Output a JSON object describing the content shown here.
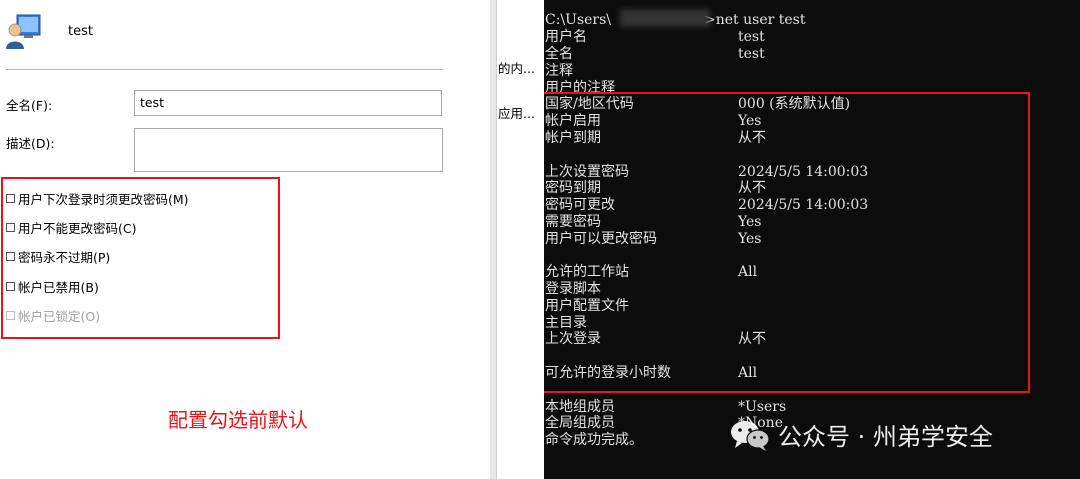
{
  "dialog": {
    "user_name": "test",
    "fullname_label": "全名(F):",
    "fullname_value": "test",
    "description_label": "描述(D):",
    "checkboxes": [
      {
        "label": "用户下次登录时须更改密码(M)",
        "checked": false,
        "disabled": false
      },
      {
        "label": "用户不能更改密码(C)",
        "checked": false,
        "disabled": false
      },
      {
        "label": "密码永不过期(P)",
        "checked": false,
        "disabled": false
      },
      {
        "label": "帐户已禁用(B)",
        "checked": false,
        "disabled": false
      },
      {
        "label": "帐户已锁定(O)",
        "checked": false,
        "disabled": true
      }
    ],
    "annotation": "配置勾选前默认"
  },
  "middle": {
    "line1": "的内...",
    "line2": "应用..."
  },
  "console": {
    "command_prefix": "C:\\Users\\",
    "command_suffix": ">net user test",
    "rows": [
      {
        "key": "用户名",
        "value": "test"
      },
      {
        "key": "全名",
        "value": "test"
      },
      {
        "key": "注释",
        "value": ""
      },
      {
        "key": "用户的注释",
        "value": ""
      },
      {
        "key": "国家/地区代码",
        "value": "000 (系统默认值)"
      },
      {
        "key": "帐户启用",
        "value": "Yes"
      },
      {
        "key": "帐户到期",
        "value": "从不"
      },
      {
        "key": "上次设置密码",
        "value": "2024/5/5 14:00:03"
      },
      {
        "key": "密码到期",
        "value": "从不"
      },
      {
        "key": "密码可更改",
        "value": "2024/5/5 14:00:03"
      },
      {
        "key": "需要密码",
        "value": "Yes"
      },
      {
        "key": "用户可以更改密码",
        "value": "Yes"
      },
      {
        "key": "允许的工作站",
        "value": "All"
      },
      {
        "key": "登录脚本",
        "value": ""
      },
      {
        "key": "用户配置文件",
        "value": ""
      },
      {
        "key": "主目录",
        "value": ""
      },
      {
        "key": "上次登录",
        "value": "从不"
      },
      {
        "key": "可允许的登录小时数",
        "value": "All"
      },
      {
        "key": "本地组成员",
        "value": "*Users"
      },
      {
        "key": "全局组成员",
        "value": "*None"
      },
      {
        "key": "命令成功完成。",
        "value": ""
      }
    ]
  },
  "watermark": {
    "text": "公众号 · 州弟学安全"
  },
  "colors": {
    "highlight": "#e8141a",
    "console_bg": "#0c0c0c",
    "console_text": "#e2e2e2"
  }
}
